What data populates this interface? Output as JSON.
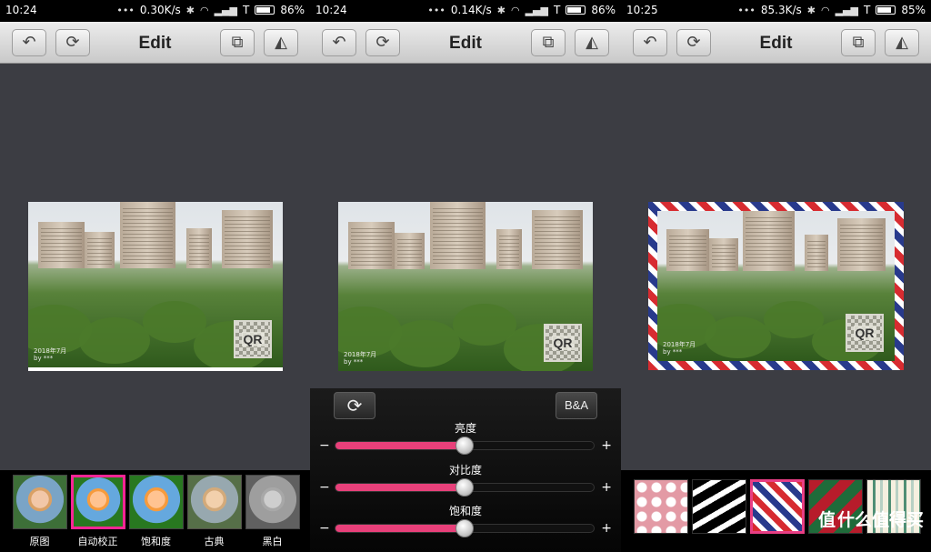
{
  "toolbar": {
    "title": "Edit"
  },
  "panels": [
    {
      "status": {
        "time": "10:24",
        "speed": "0.30K/s",
        "carrier": "T",
        "battery": "86%",
        "battery_level": 0.86
      }
    },
    {
      "status": {
        "time": "10:24",
        "speed": "0.14K/s",
        "carrier": "T",
        "battery": "86%",
        "battery_level": 0.86
      }
    },
    {
      "status": {
        "time": "10:25",
        "speed": "85.3K/s",
        "carrier": "T",
        "battery": "85%",
        "battery_level": 0.85
      }
    }
  ],
  "photo": {
    "qr_text": "QR",
    "watermark_line1": "2018年7月",
    "watermark_line2": "by ***"
  },
  "filters": [
    {
      "label": "原图"
    },
    {
      "label": "自动校正",
      "selected": true
    },
    {
      "label": "饱和度"
    },
    {
      "label": "古典"
    },
    {
      "label": "黑白"
    }
  ],
  "adjust": {
    "ba_label": "B&A",
    "sliders": [
      {
        "label": "亮度",
        "value": 0.5
      },
      {
        "label": "对比度",
        "value": 0.5
      },
      {
        "label": "饱和度",
        "value": 0.5
      }
    ]
  },
  "frames": {
    "items": [
      "polka-dots",
      "zebra",
      "airmail-stripes",
      "christmas",
      "vertical-stripes"
    ],
    "selected": "airmail-stripes"
  },
  "brand": {
    "text": "值",
    "suffix": "什么值得买"
  },
  "colors": {
    "accent": "#e8407a",
    "background": "#3c3d43"
  }
}
